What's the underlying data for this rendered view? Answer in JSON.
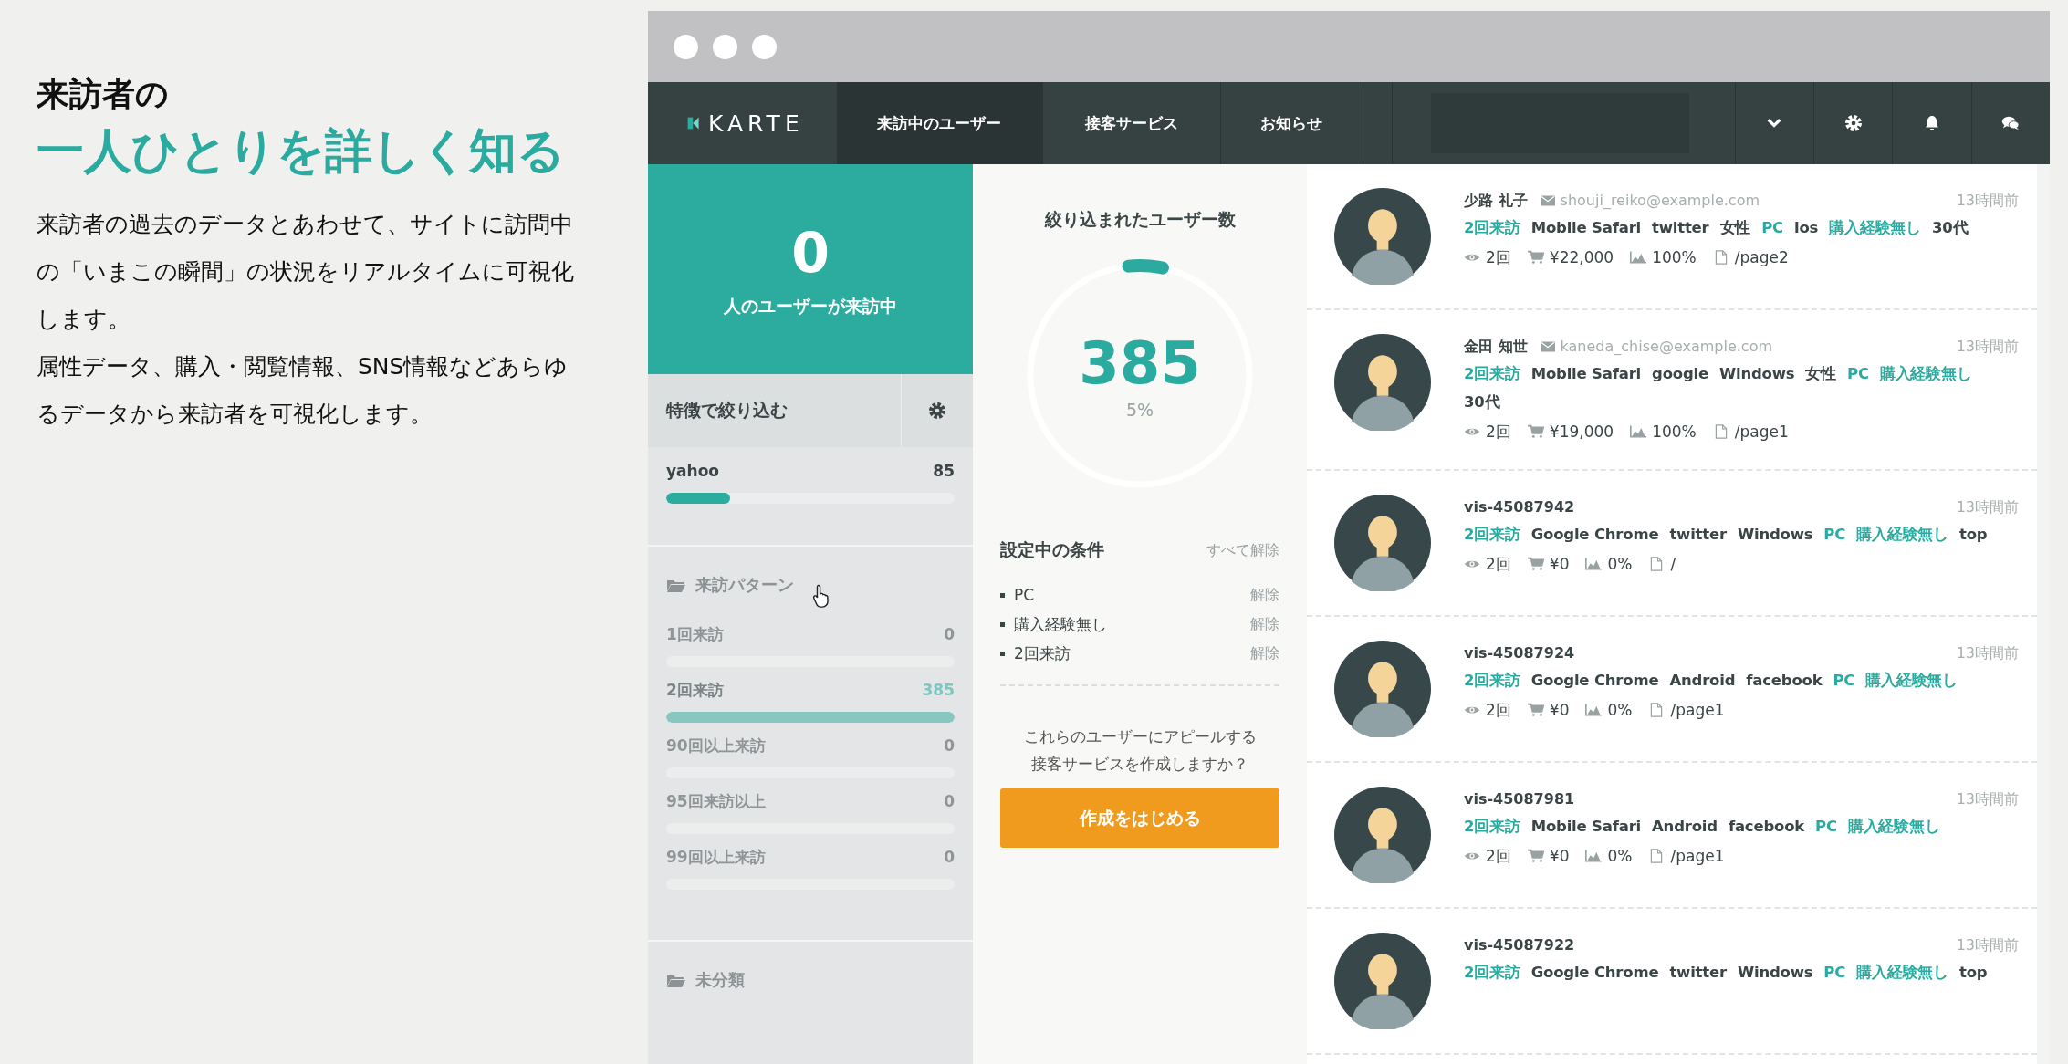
{
  "intro": {
    "title": "来訪者の",
    "headline": "一人ひとりを詳しく知る",
    "paragraphs": [
      "来訪者の過去のデータとあわせて、サイトに訪問中の「いまこの瞬間」の状況をリアルタイムに可視化します。",
      "属性データ、購入・閲覧情報、SNS情報などあらゆるデータから来訪者を可視化します。"
    ]
  },
  "app": {
    "logo": "KARTE",
    "nav": [
      {
        "label": "来訪中のユーザー",
        "selected": true
      },
      {
        "label": "接客サービス",
        "selected": false
      },
      {
        "label": "お知らせ",
        "selected": false
      }
    ],
    "live": {
      "count": "0",
      "label": "人のユーザーが来訪中"
    },
    "filter": {
      "title": "特徴で絞り込む",
      "items": [
        {
          "label": "yahoo",
          "count": "85",
          "level": 0.22
        }
      ]
    },
    "groups": [
      {
        "title": "来訪パターン",
        "items": [
          {
            "label": "1回来訪",
            "count": "0",
            "level": 0,
            "selected": false
          },
          {
            "label": "2回来訪",
            "count": "385",
            "level": 1,
            "selected": true
          },
          {
            "label": "90回以上来訪",
            "count": "0",
            "level": 0,
            "selected": false
          },
          {
            "label": "95回来訪以上",
            "count": "0",
            "level": 0,
            "selected": false
          },
          {
            "label": "99回以上来訪",
            "count": "0",
            "level": 0,
            "selected": false
          }
        ]
      },
      {
        "title": "未分類"
      }
    ],
    "summary": {
      "title": "絞り込まれたユーザー数",
      "count": "385",
      "percent": "5%",
      "level": 0.05
    },
    "conditions": {
      "title": "設定中の条件",
      "clear_all": "すべて解除",
      "items": [
        {
          "label": "PC",
          "action": "解除"
        },
        {
          "label": "購入経験無し",
          "action": "解除"
        },
        {
          "label": "2回来訪",
          "action": "解除"
        }
      ]
    },
    "prompt": [
      "これらのユーザーにアピールする",
      "接客サービスを作成しますか？"
    ],
    "cta": "作成をはじめる",
    "users": [
      {
        "name": "少路 礼子",
        "email": "shouji_reiko@example.com",
        "time": "13時間前",
        "tags": [
          {
            "label": "2回来訪",
            "matched": true
          },
          {
            "label": "Mobile Safari",
            "matched": false
          },
          {
            "label": "twitter",
            "matched": false
          },
          {
            "label": "女性",
            "matched": false
          },
          {
            "label": "PC",
            "matched": true
          },
          {
            "label": "ios",
            "matched": false
          },
          {
            "label": "購入経験無し",
            "matched": true
          },
          {
            "label": "30代",
            "matched": false
          }
        ],
        "stats": {
          "views": "2回",
          "purchase": "¥22,000",
          "rate": "100%",
          "page": "/page2"
        }
      },
      {
        "name": "金田 知世",
        "email": "kaneda_chise@example.com",
        "time": "13時間前",
        "tags": [
          {
            "label": "2回来訪",
            "matched": true
          },
          {
            "label": "Mobile Safari",
            "matched": false
          },
          {
            "label": "google",
            "matched": false
          },
          {
            "label": "Windows",
            "matched": false
          },
          {
            "label": "女性",
            "matched": false
          },
          {
            "label": "PC",
            "matched": true
          },
          {
            "label": "購入経験無し",
            "matched": true
          },
          {
            "label": "30代",
            "matched": false
          }
        ],
        "stats": {
          "views": "2回",
          "purchase": "¥19,000",
          "rate": "100%",
          "page": "/page1"
        }
      },
      {
        "name": "vis-45087942",
        "time": "13時間前",
        "tags": [
          {
            "label": "2回来訪",
            "matched": true
          },
          {
            "label": "Google Chrome",
            "matched": false
          },
          {
            "label": "twitter",
            "matched": false
          },
          {
            "label": "Windows",
            "matched": false
          },
          {
            "label": "PC",
            "matched": true
          },
          {
            "label": "購入経験無し",
            "matched": true
          },
          {
            "label": "top",
            "matched": false
          }
        ],
        "stats": {
          "views": "2回",
          "purchase": "¥0",
          "rate": "0%",
          "page": "/"
        }
      },
      {
        "name": "vis-45087924",
        "time": "13時間前",
        "tags": [
          {
            "label": "2回来訪",
            "matched": true
          },
          {
            "label": "Google Chrome",
            "matched": false
          },
          {
            "label": "Android",
            "matched": false
          },
          {
            "label": "facebook",
            "matched": false
          },
          {
            "label": "PC",
            "matched": true
          },
          {
            "label": "購入経験無し",
            "matched": true
          }
        ],
        "stats": {
          "views": "2回",
          "purchase": "¥0",
          "rate": "0%",
          "page": "/page1"
        }
      },
      {
        "name": "vis-45087981",
        "time": "13時間前",
        "tags": [
          {
            "label": "2回来訪",
            "matched": true
          },
          {
            "label": "Mobile Safari",
            "matched": false
          },
          {
            "label": "Android",
            "matched": false
          },
          {
            "label": "facebook",
            "matched": false
          },
          {
            "label": "PC",
            "matched": true
          },
          {
            "label": "購入経験無し",
            "matched": true
          }
        ],
        "stats": {
          "views": "2回",
          "purchase": "¥0",
          "rate": "0%",
          "page": "/page1"
        }
      },
      {
        "name": "vis-45087922",
        "time": "13時間前",
        "tags": [
          {
            "label": "2回来訪",
            "matched": true
          },
          {
            "label": "Google Chrome",
            "matched": false
          },
          {
            "label": "twitter",
            "matched": false
          },
          {
            "label": "Windows",
            "matched": false
          },
          {
            "label": "PC",
            "matched": true
          },
          {
            "label": "購入経験無し",
            "matched": true
          },
          {
            "label": "top",
            "matched": false
          }
        ]
      }
    ]
  }
}
